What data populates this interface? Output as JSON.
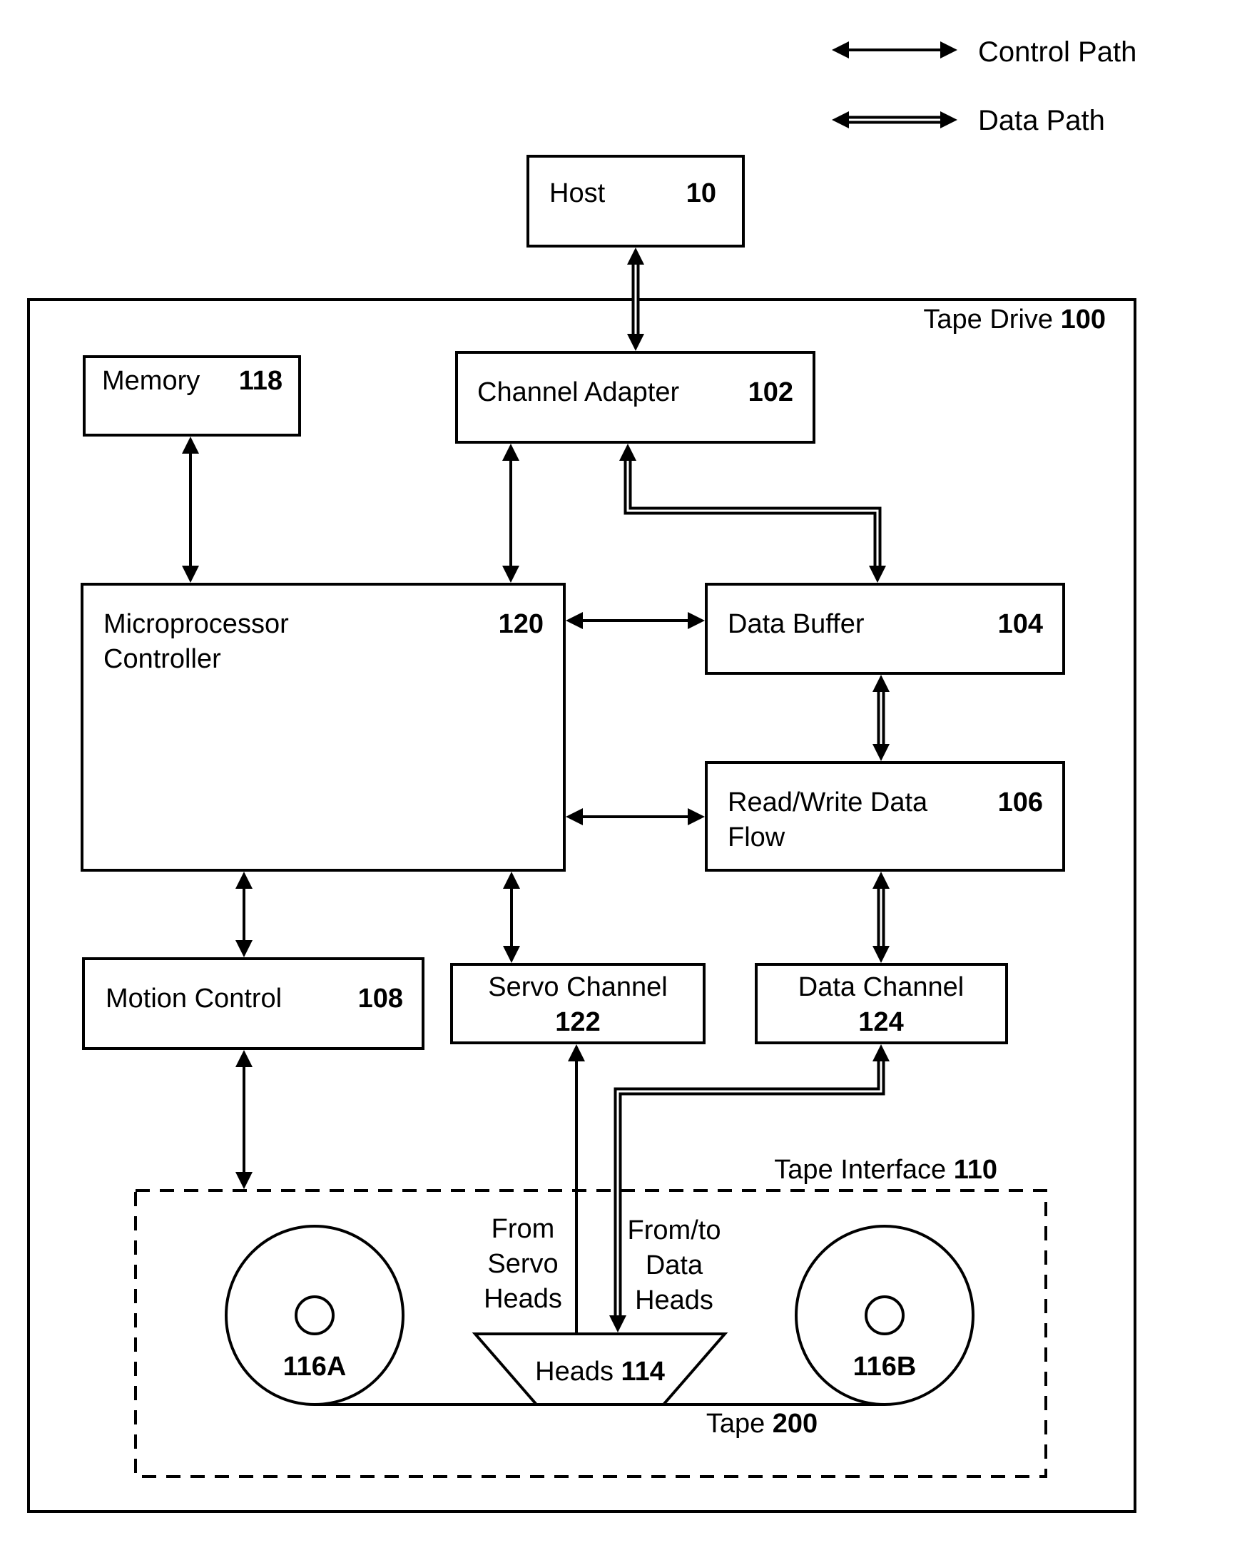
{
  "legend": {
    "control_path": "Control Path",
    "data_path": "Data Path"
  },
  "host": {
    "label": "Host",
    "num": "10"
  },
  "tape_drive": {
    "label": "Tape Drive ",
    "num": "100"
  },
  "memory": {
    "label": "Memory",
    "num": "118"
  },
  "channel_adapter": {
    "label": "Channel Adapter",
    "num": "102"
  },
  "microprocessor": {
    "line1": "Microprocessor",
    "line2": "Controller",
    "num": "120"
  },
  "data_buffer": {
    "label": "Data Buffer",
    "num": "104"
  },
  "rw_data_flow": {
    "line1": "Read/Write Data",
    "line2": "Flow",
    "num": "106"
  },
  "motion_control": {
    "label": "Motion Control",
    "num": "108"
  },
  "servo_channel": {
    "label": "Servo Channel",
    "num": "122"
  },
  "data_channel": {
    "label": "Data Channel",
    "num": "124"
  },
  "tape_interface": {
    "label": "Tape Interface ",
    "num": "110"
  },
  "servo_heads_note": [
    "From",
    "Servo",
    "Heads"
  ],
  "data_heads_note": [
    "From/to",
    "Data",
    "Heads"
  ],
  "heads": {
    "label": "Heads ",
    "num": "114"
  },
  "reel_a": {
    "num": "116A"
  },
  "reel_b": {
    "num": "116B"
  },
  "tape": {
    "label": "Tape ",
    "num": "200"
  }
}
